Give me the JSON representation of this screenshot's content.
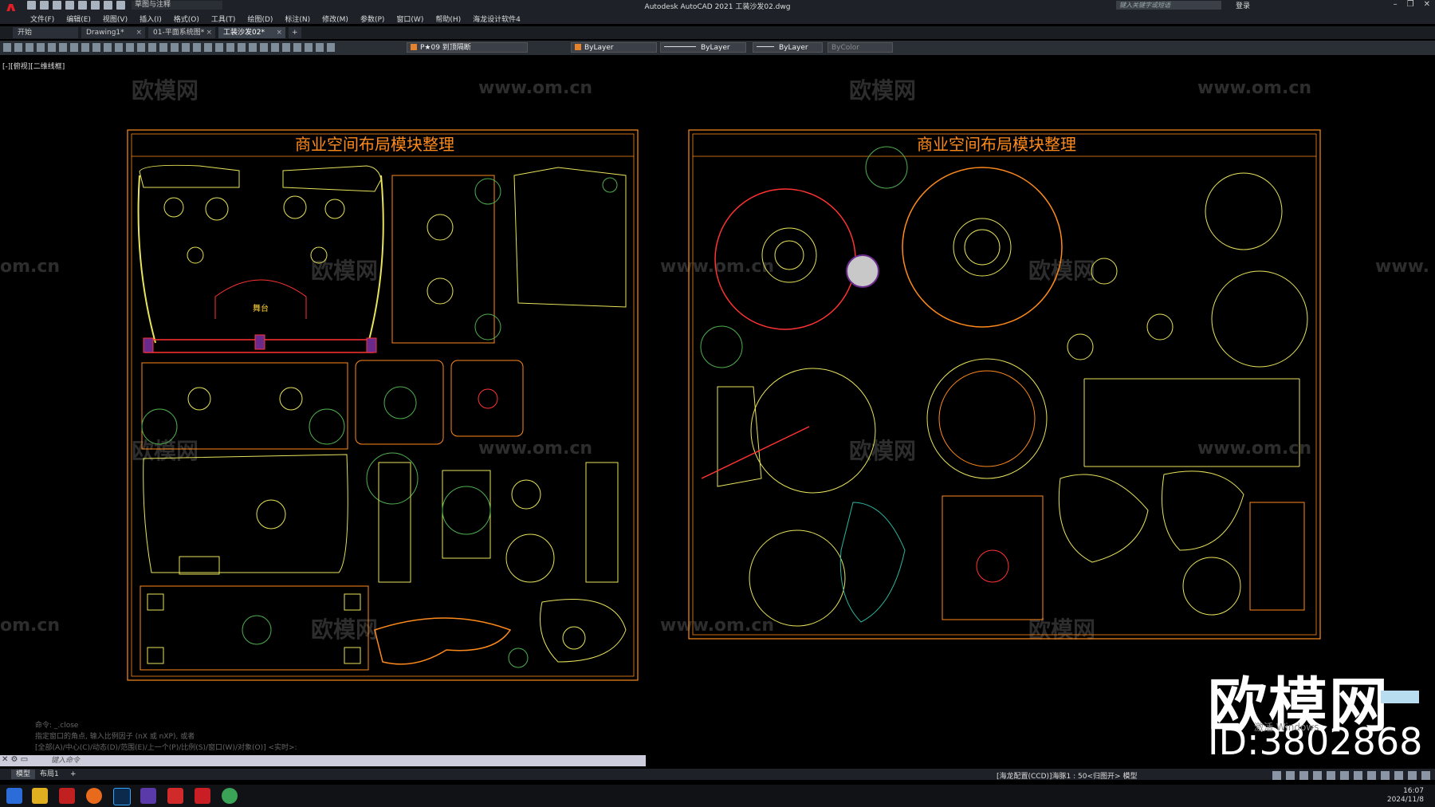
{
  "app": {
    "logo": "A",
    "title": "Autodesk AutoCAD 2021    工装沙发02.dwg",
    "workspace": "草图与注释",
    "search_placeholder": "键入关键字或短语",
    "login": "登录"
  },
  "menu": [
    "文件(F)",
    "编辑(E)",
    "视图(V)",
    "插入(I)",
    "格式(O)",
    "工具(T)",
    "绘图(D)",
    "标注(N)",
    "修改(M)",
    "参数(P)",
    "窗口(W)",
    "帮助(H)",
    "海龙设计软件4"
  ],
  "tabs": [
    {
      "label": "开始",
      "active": false
    },
    {
      "label": "Drawing1*",
      "active": false
    },
    {
      "label": "01-平面系统图*",
      "active": false
    },
    {
      "label": "工装沙发02*",
      "active": true
    }
  ],
  "toolbar": {
    "layer": "P★09 到顶隔断",
    "color": "ByLayer",
    "linetype": "ByLayer",
    "lineweight": "ByLayer",
    "plotstyle": "ByColor"
  },
  "viewport_label": "[-][俯视][二维线框]",
  "watermarks": {
    "logo": "欧模网",
    "url": "www.om.cn",
    "om": "om.cn",
    "www": "www."
  },
  "sheets": [
    {
      "title": "商业空间布局模块整理",
      "stage_label": "舞台"
    },
    {
      "title": "商业空间布局模块整理"
    }
  ],
  "overlay": {
    "logo": "欧模网",
    "id": "ID:3802868",
    "activate_windows": "激活 Windows"
  },
  "command": {
    "history": [
      "命令: _.close",
      "指定窗口的角点, 输入比例因子 (nX 或 nXP), 或者",
      "[全部(A)/中心(C)/动态(D)/范围(E)/上一个(P)/比例(S)/窗口(W)/对象(O)] <实时>:"
    ],
    "placeholder": "键入命令"
  },
  "layout_tabs": [
    "模型",
    "布局1"
  ],
  "status": {
    "text": "[海龙配置(CCD)]海豚1 : 50<归图开>",
    "model": "模型"
  },
  "taskbar": {
    "time": "16:07",
    "date": "2024/11/8"
  },
  "colors": {
    "accent_red": "#e31e25",
    "line_yellow": "#e8e35a",
    "frame_orange": "#ff8a1c"
  }
}
